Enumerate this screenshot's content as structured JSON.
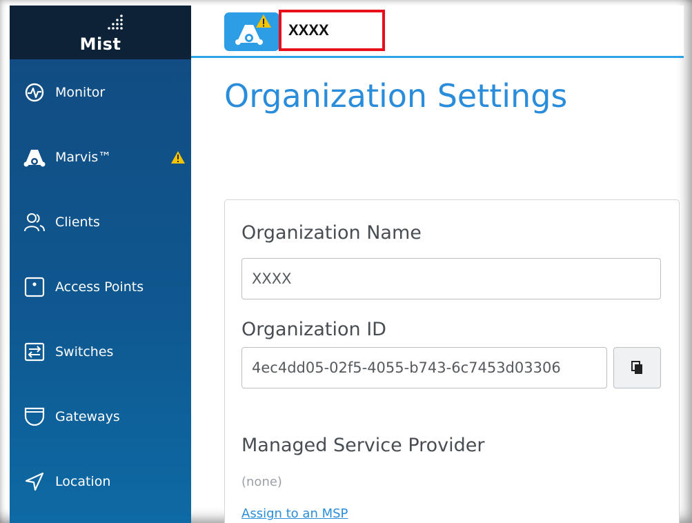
{
  "brand": {
    "logo_text": "Mist"
  },
  "sidebar": {
    "items": [
      {
        "label": "Monitor",
        "icon": "monitor-icon"
      },
      {
        "label": "Marvis™",
        "icon": "marvis-icon",
        "warning": true
      },
      {
        "label": "Clients",
        "icon": "clients-icon"
      },
      {
        "label": "Access Points",
        "icon": "access-point-icon"
      },
      {
        "label": "Switches",
        "icon": "switch-icon"
      },
      {
        "label": "Gateways",
        "icon": "gateway-icon"
      },
      {
        "label": "Location",
        "icon": "location-icon"
      }
    ]
  },
  "header": {
    "org_name": "XXXX"
  },
  "main": {
    "title": "Organization Settings",
    "org_name_label": "Organization Name",
    "org_name_value": "XXXX",
    "org_id_label": "Organization ID",
    "org_id_value": "4ec4dd05-02f5-4055-b743-6c7453d03306",
    "msp_label": "Managed Service Provider",
    "msp_value": "(none)",
    "msp_link": "Assign to an MSP"
  },
  "colors": {
    "accent": "#2a8ddb",
    "sidebar": "#124a80",
    "highlight": "#e5101b",
    "warning": "#f5c400"
  }
}
